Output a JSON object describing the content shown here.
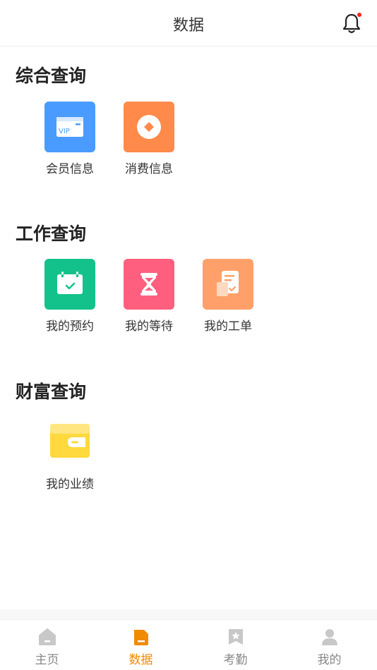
{
  "header": {
    "title": "数据"
  },
  "sections": [
    {
      "title": "综合查询",
      "items": [
        {
          "label": "会员信息",
          "icon": "vip-card-icon",
          "color": "#4a9bff",
          "badge_text": "VIP"
        },
        {
          "label": "消费信息",
          "icon": "coin-icon",
          "color": "#ff8a4a"
        }
      ]
    },
    {
      "title": "工作查询",
      "items": [
        {
          "label": "我的预约",
          "icon": "calendar-check-icon",
          "color": "#13c28a"
        },
        {
          "label": "我的等待",
          "icon": "hourglass-icon",
          "color": "#fe5f7e"
        },
        {
          "label": "我的工单",
          "icon": "work-order-icon",
          "color": "#ffa06a"
        }
      ]
    },
    {
      "title": "财富查询",
      "items": [
        {
          "label": "我的业绩",
          "icon": "wallet-icon",
          "color": "#ffd93d"
        }
      ]
    }
  ],
  "tabs": [
    {
      "label": "主页",
      "icon": "home-icon",
      "active": false
    },
    {
      "label": "数据",
      "icon": "data-icon",
      "active": true
    },
    {
      "label": "考勤",
      "icon": "bookmark-star-icon",
      "active": false
    },
    {
      "label": "我的",
      "icon": "user-icon",
      "active": false
    }
  ],
  "colors": {
    "active_tab": "#f08a00",
    "inactive_tab": "#c8c8c8",
    "notification_dot": "#ff2222"
  }
}
